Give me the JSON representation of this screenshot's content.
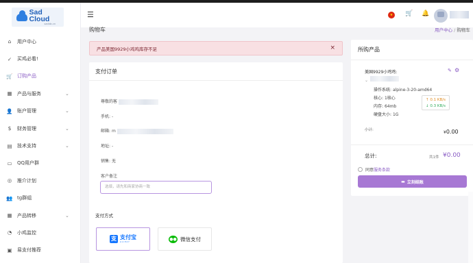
{
  "app": {
    "logo_name": "Sad Cloud",
    "logo_sub": "sadidc.cn"
  },
  "sidebar": {
    "items": [
      {
        "label": "用户中心",
        "icon": "home-icon",
        "glyph": "⌂",
        "chevron": false,
        "active": false
      },
      {
        "label": "买鸡必看!",
        "icon": "check-circle-icon",
        "glyph": "✓",
        "chevron": false,
        "active": false
      },
      {
        "label": "订购产品",
        "icon": "cart-icon",
        "glyph": "🛒",
        "chevron": false,
        "active": true
      },
      {
        "label": "产品与服务",
        "icon": "grid-icon",
        "glyph": "▦",
        "chevron": true,
        "active": false
      },
      {
        "label": "账户管理",
        "icon": "user-icon",
        "glyph": "👤",
        "chevron": true,
        "active": false
      },
      {
        "label": "财务管理",
        "icon": "money-icon",
        "glyph": "$",
        "chevron": true,
        "active": false
      },
      {
        "label": "技术支持",
        "icon": "ticket-icon",
        "glyph": "▤",
        "chevron": true,
        "active": false
      },
      {
        "label": "QQ用户群",
        "icon": "chat-icon",
        "glyph": "▭",
        "chevron": false,
        "active": false
      },
      {
        "label": "推介计划",
        "icon": "share-icon",
        "glyph": "◎",
        "chevron": false,
        "active": false
      },
      {
        "label": "tg群组",
        "icon": "group-icon",
        "glyph": "👥",
        "chevron": false,
        "active": false
      },
      {
        "label": "产品转移",
        "icon": "transfer-icon",
        "glyph": "▦",
        "chevron": true,
        "active": false
      },
      {
        "label": "小鸡监控",
        "icon": "monitor-icon",
        "glyph": "◔",
        "chevron": false,
        "active": false
      },
      {
        "label": "易支付推荐",
        "icon": "pay-icon",
        "glyph": "▣",
        "chevron": false,
        "active": false
      }
    ]
  },
  "header": {
    "menu_icon": "hamburger-icon",
    "flag": "cn-flag-icon"
  },
  "page": {
    "title": "购物车",
    "breadcrumb_home": "用户中心",
    "breadcrumb_sep": "/",
    "breadcrumb_current": "购物车"
  },
  "alert": {
    "message": "产品美国9929小鸡鸡库存不足",
    "close": "×"
  },
  "payment": {
    "title": "支付订单",
    "customer_label": "尊敬的客",
    "phone_label": "手机:",
    "phone_value": "-",
    "email_label": "邮箱:",
    "email_value": "m",
    "address_label": "地址:",
    "address_value": "-",
    "sales_label": "销售:",
    "sales_value": "无",
    "remark_label": "客户备注",
    "remark_placeholder": "选填，请先和商家协商一致",
    "methods_label": "支付方式",
    "alipay_label": "支付宝",
    "alipay_sub": "ALIPAY",
    "wechat_label": "微信支付"
  },
  "products": {
    "title": "所购产品",
    "name": "美国9929小鸡鸡:",
    "os_label": "操作系统:",
    "os_value": "alpine-3-20-amd64",
    "cpu_label": "核心:",
    "cpu_value": "1核心",
    "mem_label": "内存:",
    "mem_value": "64mb",
    "disk_label": "硬盘大小:",
    "disk_value": "1G",
    "speed_up": "↑ 0.1 KB/s",
    "speed_down": "↓ 0.3 KB/s",
    "subtotal_label": "小计:",
    "subtotal_currency": "¥",
    "subtotal_value": "0.00",
    "total_label": "总计:",
    "total_count": "共1件",
    "total_value": "¥0.00",
    "agree_text": "同意",
    "agree_link": "服务条款",
    "pay_button": "立刻结账"
  }
}
